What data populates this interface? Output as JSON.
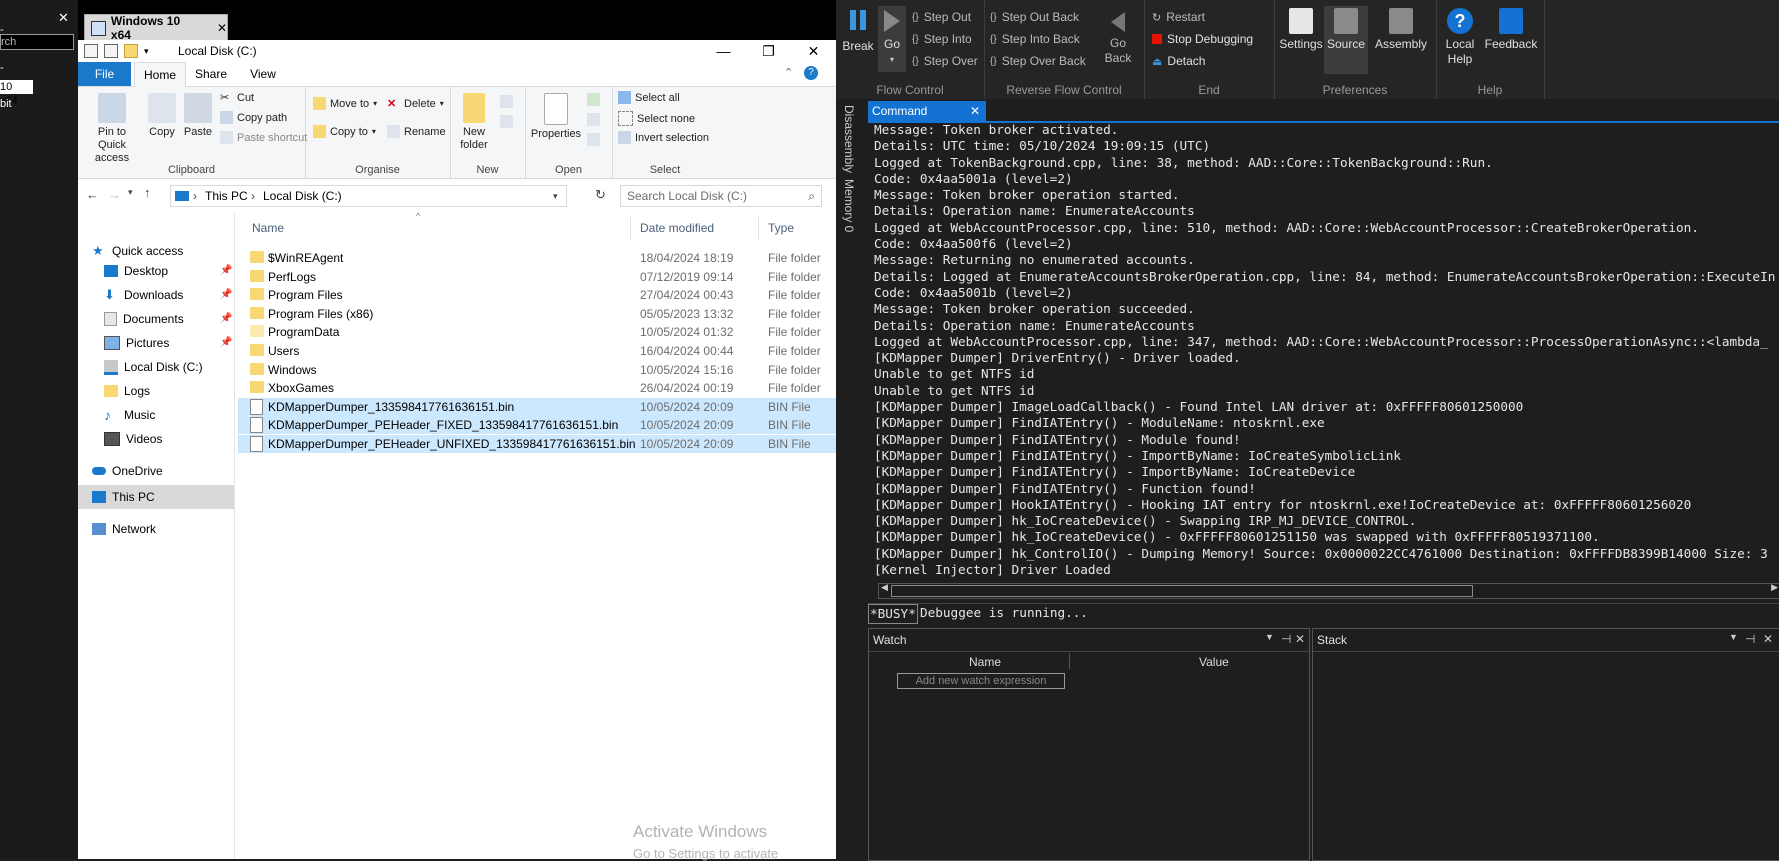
{
  "vm_left": {
    "search_text": "rch",
    "selected_text": "10 x64",
    "label_bit": "bit",
    "label_dash": "-"
  },
  "vm_tab": {
    "title": "Windows 10 x64"
  },
  "explorer": {
    "window_title": "Local Disk (C:)",
    "ribbon_tabs": [
      "File",
      "Home",
      "Share",
      "View"
    ],
    "clipboard": {
      "pin": "Pin to Quick access",
      "copy": "Copy",
      "paste": "Paste",
      "cut": "Cut",
      "copy_path": "Copy path",
      "paste_shortcut": "Paste shortcut",
      "label": "Clipboard"
    },
    "organise": {
      "move_to": "Move to",
      "copy_to": "Copy to",
      "delete": "Delete",
      "rename": "Rename",
      "label": "Organise"
    },
    "new": {
      "new_folder": "New folder",
      "label": "New"
    },
    "open": {
      "properties": "Properties",
      "label": "Open"
    },
    "select": {
      "select_all": "Select all",
      "select_none": "Select none",
      "invert": "Invert selection",
      "label": "Select"
    },
    "address": {
      "this_pc": "This PC",
      "drive": "Local Disk (C:)"
    },
    "search_placeholder": "Search Local Disk (C:)",
    "nav": [
      {
        "label": "Quick access"
      },
      {
        "label": "Desktop"
      },
      {
        "label": "Downloads"
      },
      {
        "label": "Documents"
      },
      {
        "label": "Pictures"
      },
      {
        "label": "Local Disk (C:)"
      },
      {
        "label": "Logs"
      },
      {
        "label": "Music"
      },
      {
        "label": "Videos"
      },
      {
        "label": "OneDrive"
      },
      {
        "label": "This PC"
      },
      {
        "label": "Network"
      }
    ],
    "columns": {
      "name": "Name",
      "date": "Date modified",
      "type": "Type"
    },
    "files": [
      {
        "name": "$WinREAgent",
        "date": "18/04/2024 18:19",
        "type": "File folder"
      },
      {
        "name": "PerfLogs",
        "date": "07/12/2019 09:14",
        "type": "File folder"
      },
      {
        "name": "Program Files",
        "date": "27/04/2024 00:43",
        "type": "File folder"
      },
      {
        "name": "Program Files (x86)",
        "date": "05/05/2023 13:32",
        "type": "File folder"
      },
      {
        "name": "ProgramData",
        "date": "10/05/2024 01:32",
        "type": "File folder"
      },
      {
        "name": "Users",
        "date": "16/04/2024 00:44",
        "type": "File folder"
      },
      {
        "name": "Windows",
        "date": "10/05/2024 15:16",
        "type": "File folder"
      },
      {
        "name": "XboxGames",
        "date": "26/04/2024 00:19",
        "type": "File folder"
      },
      {
        "name": "KDMapperDumper_133598417761636151.bin",
        "date": "10/05/2024 20:09",
        "type": "BIN File"
      },
      {
        "name": "KDMapperDumper_PEHeader_FIXED_133598417761636151.bin",
        "date": "10/05/2024 20:09",
        "type": "BIN File"
      },
      {
        "name": "KDMapperDumper_PEHeader_UNFIXED_133598417761636151.bin",
        "date": "10/05/2024 20:09",
        "type": "BIN File"
      }
    ],
    "watermark_1": "Activate Windows",
    "watermark_2": "Go to Settings to activate"
  },
  "debugger": {
    "flow": {
      "break": "Break",
      "go": "Go",
      "step_out": "Step Out",
      "step_into": "Step Into",
      "step_over": "Step Over",
      "label": "Flow Control"
    },
    "reverse": {
      "step_out_back": "Step Out Back",
      "step_into_back": "Step Into Back",
      "step_over_back": "Step Over Back",
      "go_back": "Go Back",
      "label": "Reverse Flow Control"
    },
    "end": {
      "restart": "Restart",
      "stop": "Stop Debugging",
      "detach": "Detach",
      "label": "End"
    },
    "prefs": {
      "settings": "Settings",
      "source": "Source",
      "assembly": "Assembly",
      "label": "Preferences"
    },
    "help": {
      "local_help": "Local Help",
      "feedback": "Feedback",
      "label": "Help"
    },
    "side_tabs": [
      "Disassembly",
      "Memory 0"
    ],
    "command_tab": "Command",
    "command_lines": [
      "Message: Token broker activated.",
      "Details: UTC time: 05/10/2024 19:09:15 (UTC)",
      "Logged at TokenBackground.cpp, line: 38, method: AAD::Core::TokenBackground::Run.",
      "Code: 0x4aa5001a (level=2)",
      "Message: Token broker operation started.",
      "Details: Operation name: EnumerateAccounts",
      "Logged at WebAccountProcessor.cpp, line: 510, method: AAD::Core::WebAccountProcessor::CreateBrokerOperation.",
      "Code: 0x4aa500f6 (level=2)",
      "Message: Returning no enumerated accounts.",
      "Details: Logged at EnumerateAccountsBrokerOperation.cpp, line: 84, method: EnumerateAccountsBrokerOperation::ExecuteIn",
      "Code: 0x4aa5001b (level=2)",
      "Message: Token broker operation succeeded.",
      "Details: Operation name: EnumerateAccounts",
      "Logged at WebAccountProcessor.cpp, line: 347, method: AAD::Core::WebAccountProcessor::ProcessOperationAsync::<lambda_",
      "[KDMapper Dumper] DriverEntry() - Driver loaded.",
      "Unable to get NTFS id",
      "Unable to get NTFS id",
      "[KDMapper Dumper] ImageLoadCallback() - Found Intel LAN driver at: 0xFFFFF80601250000",
      "[KDMapper Dumper] FindIATEntry() - ModuleName: ntoskrnl.exe",
      "[KDMapper Dumper] FindIATEntry() - Module found!",
      "[KDMapper Dumper] FindIATEntry() - ImportByName: IoCreateSymbolicLink",
      "[KDMapper Dumper] FindIATEntry() - ImportByName: IoCreateDevice",
      "[KDMapper Dumper] FindIATEntry() - Function found!",
      "[KDMapper Dumper] HookIATEntry() - Hooking IAT entry for ntoskrnl.exe!IoCreateDevice at: 0xFFFFF80601256020",
      "[KDMapper Dumper] hk_IoCreateDevice() - Swapping IRP_MJ_DEVICE_CONTROL.",
      "[KDMapper Dumper] hk_IoCreateDevice() - 0xFFFFF80601251150 was swapped with 0xFFFFF80519371100.",
      "[KDMapper Dumper] hk_ControlIO() - Dumping Memory! Source: 0x0000022CC4761000 Destination: 0xFFFFDB8399B14000 Size: 3",
      "[Kernel Injector] Driver Loaded"
    ],
    "busy": "*BUSY*",
    "status": "Debuggee is running...",
    "watch": {
      "title": "Watch",
      "col_name": "Name",
      "col_value": "Value",
      "placeholder": "Add new watch expression"
    },
    "stack": {
      "title": "Stack"
    }
  }
}
